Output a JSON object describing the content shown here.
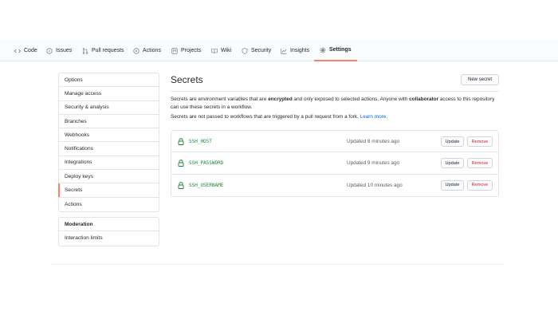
{
  "tabs": [
    {
      "label": "Code",
      "icon": "code-icon"
    },
    {
      "label": "Issues",
      "icon": "issue-icon"
    },
    {
      "label": "Pull requests",
      "icon": "pull-request-icon"
    },
    {
      "label": "Actions",
      "icon": "play-icon"
    },
    {
      "label": "Projects",
      "icon": "project-icon"
    },
    {
      "label": "Wiki",
      "icon": "book-icon"
    },
    {
      "label": "Security",
      "icon": "shield-icon"
    },
    {
      "label": "Insights",
      "icon": "graph-icon"
    },
    {
      "label": "Settings",
      "icon": "gear-icon",
      "selected": true
    }
  ],
  "sidebar": {
    "items": [
      {
        "label": "Options"
      },
      {
        "label": "Manage access"
      },
      {
        "label": "Security & analysis"
      },
      {
        "label": "Branches"
      },
      {
        "label": "Webhooks"
      },
      {
        "label": "Notifications"
      },
      {
        "label": "Integrations"
      },
      {
        "label": "Deploy keys"
      },
      {
        "label": "Secrets",
        "selected": true
      },
      {
        "label": "Actions"
      }
    ],
    "moderation": {
      "heading": "Moderation",
      "items": [
        {
          "label": "Interaction limits"
        }
      ]
    }
  },
  "main": {
    "title": "Secrets",
    "new_button": "New secret",
    "description": {
      "part1": "Secrets are environment variables that are ",
      "bold1": "encrypted",
      "part2": " and only exposed to selected actions. Anyone with ",
      "bold2": "collaborator",
      "part3": " access to this repository can use these secrets in a workflow."
    },
    "note": "Secrets are not passed to workflows that are triggered by a pull request from a fork. ",
    "learn_more": "Learn more.",
    "update_label": "Update",
    "remove_label": "Remove",
    "secrets": [
      {
        "name": "SSH_HOST",
        "updated": "Updated 8 minutes ago"
      },
      {
        "name": "SSH_PASSWORD",
        "updated": "Updated 9 minutes ago"
      },
      {
        "name": "SSH_USERNAME",
        "updated": "Updated 10 minutes ago"
      }
    ]
  },
  "colors": {
    "accent_tab": "#f9826c",
    "secret_name": "#22863a",
    "remove_text": "#cb2431",
    "link": "#0366d6"
  }
}
